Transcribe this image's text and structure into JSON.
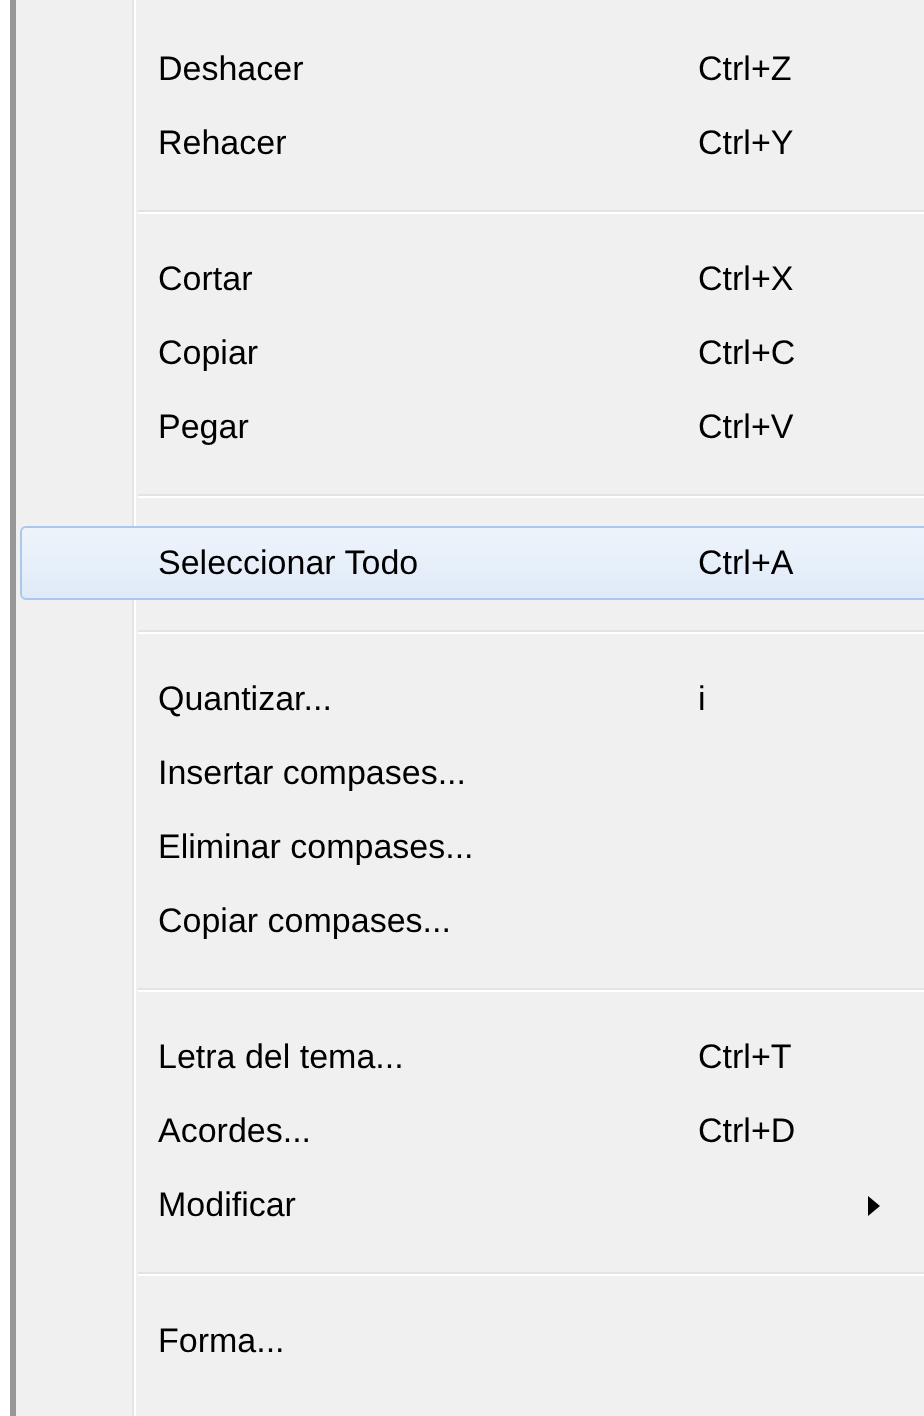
{
  "menu": {
    "groups": [
      [
        {
          "label": "Deshacer",
          "shortcut": "Ctrl+Z",
          "kind": "item",
          "selected": false
        },
        {
          "label": "Rehacer",
          "shortcut": "Ctrl+Y",
          "kind": "item",
          "selected": false
        }
      ],
      [
        {
          "label": "Cortar",
          "shortcut": "Ctrl+X",
          "kind": "item",
          "selected": false
        },
        {
          "label": "Copiar",
          "shortcut": "Ctrl+C",
          "kind": "item",
          "selected": false
        },
        {
          "label": "Pegar",
          "shortcut": "Ctrl+V",
          "kind": "item",
          "selected": false
        }
      ],
      [
        {
          "label": "Seleccionar Todo",
          "shortcut": "Ctrl+A",
          "kind": "item",
          "selected": true
        }
      ],
      [
        {
          "label": "Quantizar...",
          "shortcut": "i",
          "kind": "item",
          "selected": false
        },
        {
          "label": "Insertar compases...",
          "kind": "item",
          "selected": false
        },
        {
          "label": "Eliminar compases...",
          "kind": "item",
          "selected": false
        },
        {
          "label": "Copiar compases...",
          "kind": "item",
          "selected": false
        }
      ],
      [
        {
          "label": "Letra del tema...",
          "shortcut": "Ctrl+T",
          "kind": "item",
          "selected": false
        },
        {
          "label": "Acordes...",
          "shortcut": "Ctrl+D",
          "kind": "item",
          "selected": false
        },
        {
          "label": "Modificar",
          "kind": "submenu",
          "selected": false
        }
      ],
      [
        {
          "label": "Forma...",
          "kind": "item",
          "selected": false
        }
      ]
    ]
  }
}
